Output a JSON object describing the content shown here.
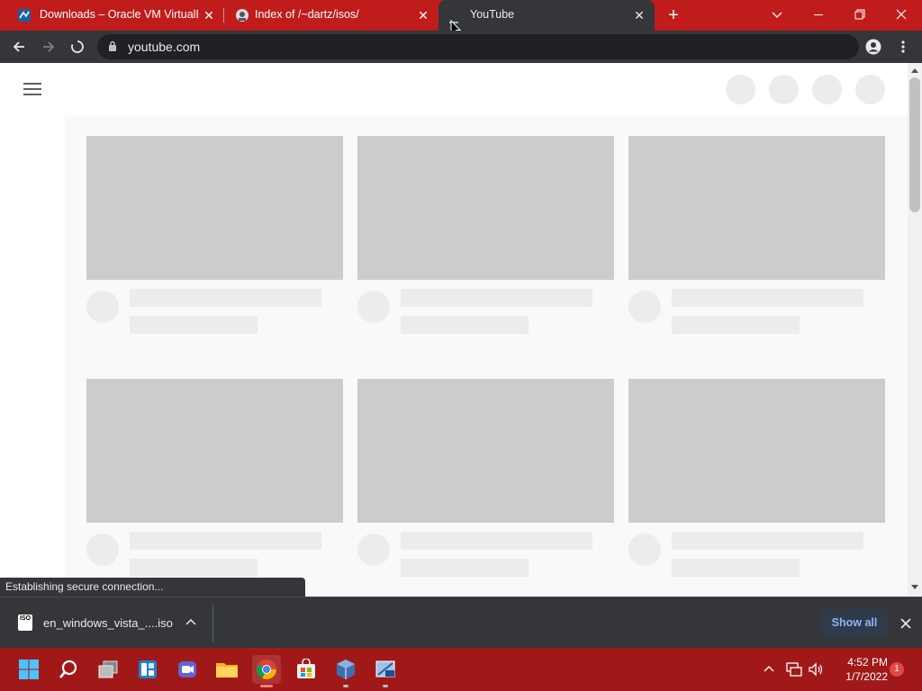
{
  "browser": {
    "tabs": [
      {
        "title": "Downloads – Oracle VM VirtualBox",
        "active": false
      },
      {
        "title": "Index of /~dartz/isos/",
        "active": false
      },
      {
        "title": "YouTube",
        "active": true
      }
    ],
    "url": "youtube.com"
  },
  "page": {
    "loading": true,
    "skeleton_rows": 2,
    "skeleton_columns": 3
  },
  "status_bar": {
    "text": "Establishing secure connection..."
  },
  "download_shelf": {
    "file_name": "en_windows_vista_....iso",
    "file_icon_text": "ISO",
    "show_all_label": "Show all"
  },
  "taskbar": {
    "time": "4:52 PM",
    "date": "1/7/2022",
    "notification_count": "1"
  },
  "colors": {
    "tab_strip": "#c01c1c",
    "taskbar": "#a11818",
    "toolbar": "#35363a",
    "skeleton": "#cccccc",
    "accent_link": "#8ab4f8"
  }
}
